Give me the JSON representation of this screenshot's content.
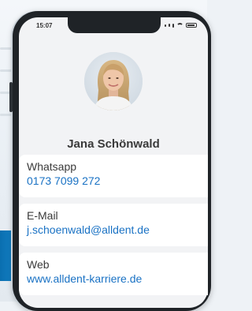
{
  "status_bar": {
    "time": "15:07"
  },
  "contact": {
    "name": "Jana Schönwald",
    "avatar_icon": "person-photo"
  },
  "fields": [
    {
      "label": "Whatsapp",
      "value": "0173 7099 272"
    },
    {
      "label": "E-Mail",
      "value": "j.schoenwald@alldent.de"
    },
    {
      "label": "Web",
      "value": "www.alldent-karriere.de"
    }
  ],
  "colors": {
    "link": "#1a72c4",
    "accent": "#0a6fb0",
    "phone_frame": "#1f2327"
  }
}
